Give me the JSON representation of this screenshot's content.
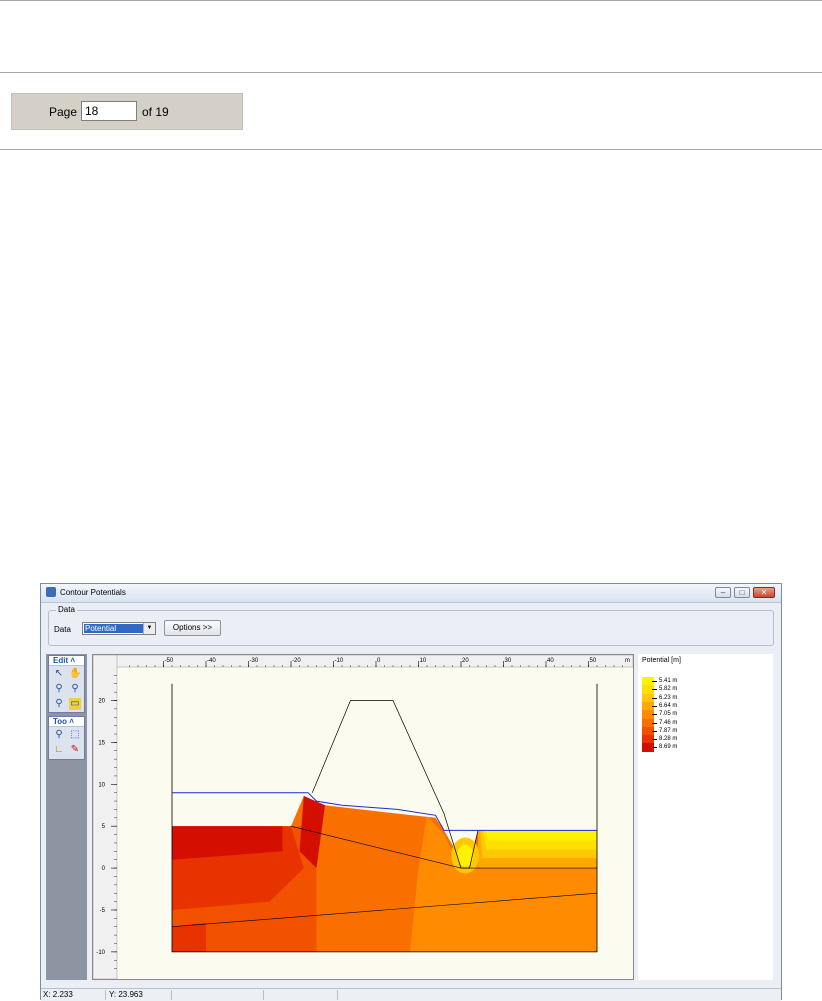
{
  "pager": {
    "label": "Page",
    "current": "18",
    "total_label": "of 19"
  },
  "window": {
    "title": "Contour Potentials",
    "data_group": {
      "legend": "Data",
      "label": "Data",
      "selected": "Potential",
      "options_button": "Options >>"
    },
    "toolbox": {
      "edit_header": "Edit",
      "tools_header": "Too"
    },
    "status": {
      "x": "X: 2.233",
      "y": "Y: 23.963"
    }
  },
  "chart_data": {
    "type": "heatmap",
    "title": "",
    "legend_title": "Potential [m]",
    "legend_entries": [
      "5.41 m",
      "5.82 m",
      "6.23 m",
      "6.64 m",
      "7.05 m",
      "7.46 m",
      "7.87 m",
      "8.28 m",
      "8.69 m"
    ],
    "legend_colors": [
      "#fff200",
      "#ffe000",
      "#ffc800",
      "#ffa800",
      "#ff8c00",
      "#fa7000",
      "#f25200",
      "#e83200",
      "#d40e00"
    ],
    "x_ticks": [
      "-50",
      "-40",
      "-30",
      "-20",
      "-10",
      "0",
      "10",
      "20",
      "30",
      "40",
      "50"
    ],
    "x_unit": "m",
    "y_ticks": [
      "20",
      "15",
      "10",
      "5",
      "0",
      "-5",
      "-10"
    ],
    "xlim": [
      -60,
      60
    ],
    "ylim": [
      -13,
      24
    ],
    "grid": false
  }
}
